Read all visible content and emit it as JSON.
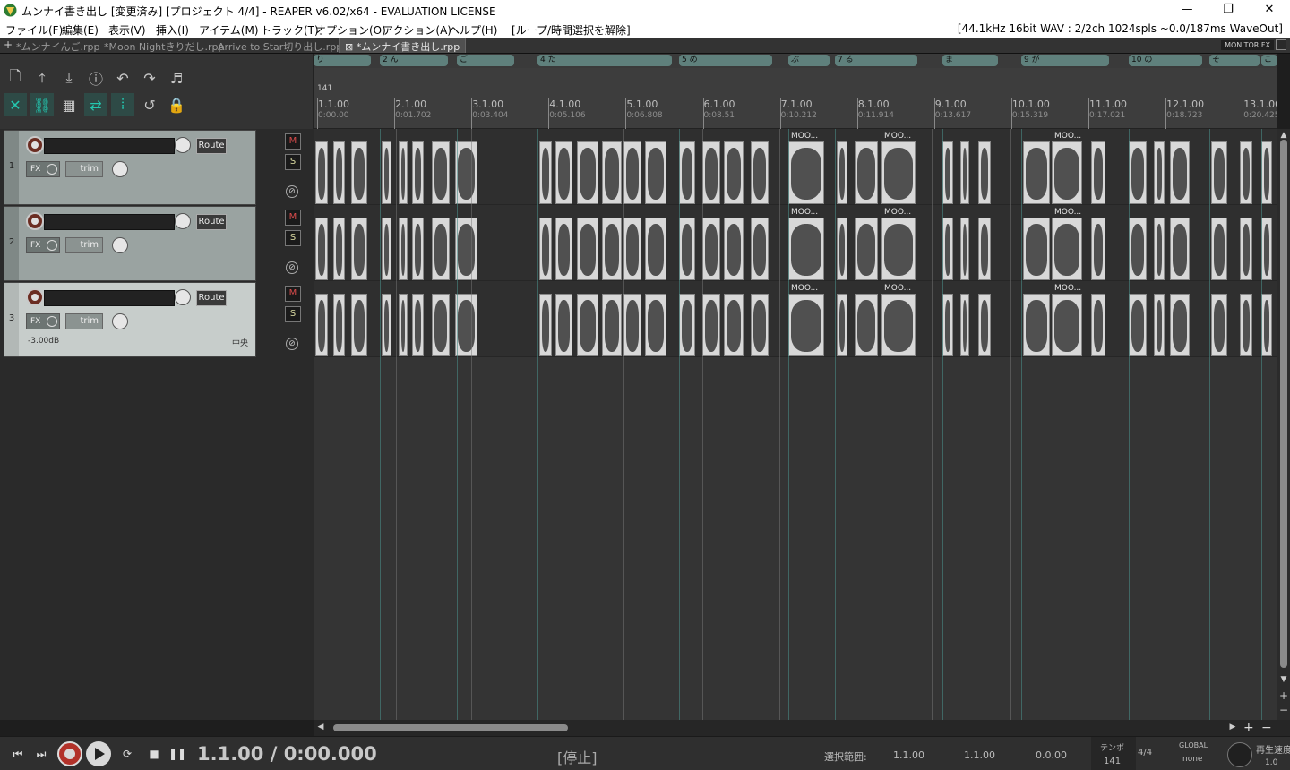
{
  "window": {
    "title": "ムンナイ書き出し [変更済み] [プロジェクト 4/4] - REAPER v6.02/x64 - EVALUATION LICENSE",
    "minimize": "—",
    "maximize": "❐",
    "close": "✕"
  },
  "menu": {
    "items": [
      "ファイル(F)",
      "編集(E)",
      "表示(V)",
      "挿入(I)",
      "アイテム(M)",
      "トラック(T)",
      "オプション(O)",
      "アクション(A)",
      "ヘルプ(H)",
      "[ループ/時間選択を解除]"
    ],
    "status": "[44.1kHz 16bit WAV : 2/2ch 1024spls ~0.0/187ms WaveOut]"
  },
  "tabs": {
    "new": "+",
    "items": [
      "*ムンナイんご.rpp",
      "*Moon Nightきりだし.rpp",
      "Arrive to Star切り出し.rpp",
      "*ムンナイ書き出し.rpp"
    ],
    "active_index": 3,
    "close_glyph": "⊠",
    "monitor_fx": "MONITOR FX"
  },
  "toolbar": {
    "icons": [
      "new-project-icon",
      "open-project-icon",
      "save-project-icon",
      "info-icon",
      "undo-icon",
      "redo-icon",
      "metronome-icon",
      "ripple-edit-icon",
      "link-icon",
      "grid-icon",
      "item-grouping-icon",
      "snap-icon",
      "loop-icon",
      "lock-icon"
    ],
    "glyphs": [
      "🗋",
      "⤒",
      "⤓",
      "ⓘ",
      "↶",
      "↷",
      "♬",
      "✕",
      "⛓",
      "▦",
      "⇄",
      "⦙",
      "↺",
      "🔒"
    ]
  },
  "tracks": [
    {
      "number": "1",
      "route": "Route",
      "fx": "FX",
      "trim": "trim",
      "mute": "M",
      "solo": "S",
      "phase": "⊘",
      "volume": "",
      "pan": ""
    },
    {
      "number": "2",
      "route": "Route",
      "fx": "FX",
      "trim": "trim",
      "mute": "M",
      "solo": "S",
      "phase": "⊘",
      "volume": "",
      "pan": ""
    },
    {
      "number": "3",
      "route": "Route",
      "fx": "FX",
      "trim": "trim",
      "mute": "M",
      "solo": "S",
      "phase": "⊘",
      "volume": "-3.00dB",
      "pan": "中央"
    }
  ],
  "regions": [
    "り",
    "2 ん",
    "ご",
    "4 た",
    "5 め",
    "ぶ",
    "7 る",
    "ま",
    "9 が",
    "10 の",
    "そ",
    "こ"
  ],
  "ruler": {
    "tempo_marker": "141",
    "bars": [
      "1.1.00",
      "2.1.00",
      "3.1.00",
      "4.1.00",
      "5.1.00",
      "6.1.00",
      "7.1.00",
      "8.1.00",
      "9.1.00",
      "10.1.00",
      "11.1.00",
      "12.1.00",
      "13.1.00"
    ],
    "times": [
      "0:00.00",
      "0:01.702",
      "0:03.404",
      "0:05.106",
      "0:06.808",
      "0:08.51",
      "0:10.212",
      "0:11.914",
      "0:13.617",
      "0:15.319",
      "0:17.021",
      "0:18.723",
      "0:20.425"
    ]
  },
  "item_label": "MOO...",
  "transport": {
    "position": "1.1.00 / 0:00.000",
    "state": "[停止]",
    "selection_label": "選択範囲:",
    "selection_start": "1.1.00",
    "selection_end": "1.1.00",
    "selection_length": "0.0.00",
    "tempo_label": "テンポ",
    "tempo": "141",
    "time_signature": "4/4",
    "global": "GLOBAL",
    "none": "none",
    "rate_label": "再生速度",
    "rate": "1.0"
  },
  "colors": {
    "accent": "#24c7b0",
    "region": "#5f807c",
    "record": "#b2322a",
    "mute": "#d94b4b"
  }
}
